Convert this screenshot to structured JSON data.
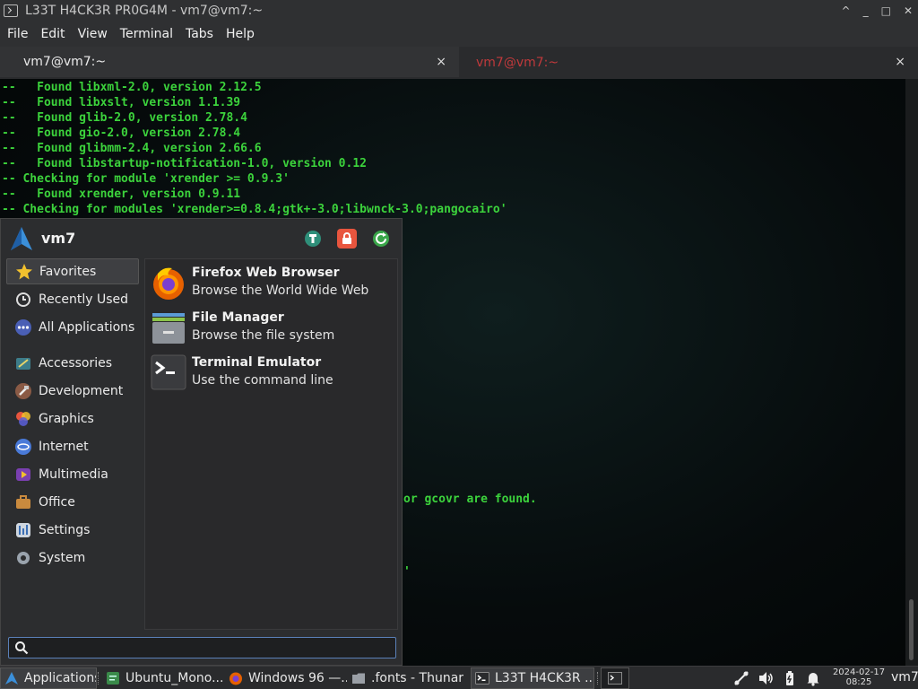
{
  "window": {
    "title": "L33T H4CK3R PR0G4M - vm7@vm7:~",
    "controls": [
      "^",
      "_",
      "□",
      "✕"
    ]
  },
  "menubar": [
    "File",
    "Edit",
    "View",
    "Terminal",
    "Tabs",
    "Help"
  ],
  "tabs": [
    {
      "label": "vm7@vm7:~",
      "close": "×"
    },
    {
      "label": "vm7@vm7:~",
      "close": "×"
    }
  ],
  "terminal": {
    "lines": [
      "--   Found libxml-2.0, version 2.12.5",
      "--   Found libxslt, version 1.1.39",
      "--   Found glib-2.0, version 2.78.4",
      "--   Found gio-2.0, version 2.78.4",
      "--   Found glibmm-2.4, version 2.66.6",
      "--   Found libstartup-notification-1.0, version 0.12",
      "-- Checking for module 'xrender >= 0.9.3'",
      "--   Found xrender, version 0.9.11",
      "-- Checking for modules 'xrender>=0.8.4;gtk+-3.0;libwnck-3.0;pangocairo'"
    ],
    "partial_lines": [
      "or gcovr are found.",
      "'"
    ]
  },
  "appmenu": {
    "username": "vm7",
    "header_buttons": [
      "settings-manager-icon",
      "lock-icon",
      "logout-icon"
    ],
    "categories": [
      {
        "label": "Favorites",
        "icon": "star-icon",
        "selected": true
      },
      {
        "label": "Recently Used",
        "icon": "clock-icon"
      },
      {
        "label": "All Applications",
        "icon": "all-apps-icon"
      },
      {
        "label": "Accessories",
        "icon": "accessories-icon"
      },
      {
        "label": "Development",
        "icon": "development-icon"
      },
      {
        "label": "Graphics",
        "icon": "graphics-icon"
      },
      {
        "label": "Internet",
        "icon": "internet-icon"
      },
      {
        "label": "Multimedia",
        "icon": "multimedia-icon"
      },
      {
        "label": "Office",
        "icon": "office-icon"
      },
      {
        "label": "Settings",
        "icon": "settings-icon"
      },
      {
        "label": "System",
        "icon": "system-icon"
      }
    ],
    "apps": [
      {
        "name": "Firefox Web Browser",
        "desc": "Browse the World Wide Web",
        "icon": "firefox-icon"
      },
      {
        "name": "File Manager",
        "desc": "Browse the file system",
        "icon": "file-manager-icon"
      },
      {
        "name": "Terminal Emulator",
        "desc": "Use the command line",
        "icon": "terminal-icon"
      }
    ],
    "search": {
      "value": "",
      "placeholder": ""
    }
  },
  "taskbar": {
    "applications_label": "Applications",
    "windows": [
      {
        "label": "Ubuntu_Mono....",
        "icon": "text-editor-icon"
      },
      {
        "label": "Windows 96 —...",
        "icon": "firefox-icon"
      },
      {
        "label": ".fonts - Thunar",
        "icon": "folder-icon"
      },
      {
        "label": "L33T H4CK3R ...",
        "icon": "terminal-icon",
        "active": true
      }
    ],
    "clock_date": "2024-02-17",
    "clock_time": "08:25",
    "user": "vm7"
  },
  "colors": {
    "terminal_text": "#3cd33c",
    "inactive_tab_text": "#c0393b",
    "accent": "#5a80b8"
  }
}
